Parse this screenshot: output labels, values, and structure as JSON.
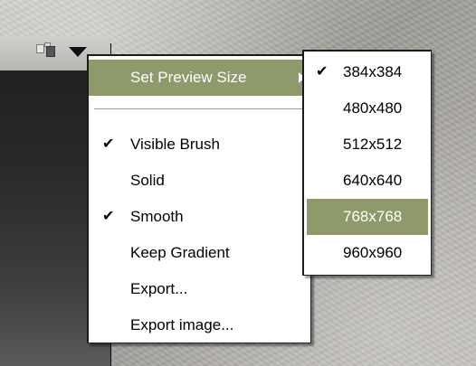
{
  "main_menu": {
    "items": [
      {
        "label": "Set Preview Size",
        "checked": false,
        "highlighted": true,
        "has_submenu": true
      },
      {
        "label": "Visible Brush",
        "checked": true
      },
      {
        "label": "Solid",
        "checked": false
      },
      {
        "label": "Smooth",
        "checked": true
      },
      {
        "label": "Keep Gradient",
        "checked": false
      },
      {
        "label": "Export...",
        "checked": false
      },
      {
        "label": "Export image...",
        "checked": false
      }
    ]
  },
  "submenu": {
    "items": [
      {
        "label": "384x384",
        "checked": true
      },
      {
        "label": "480x480",
        "checked": false
      },
      {
        "label": "512x512",
        "checked": false
      },
      {
        "label": "640x640",
        "checked": false
      },
      {
        "label": "768x768",
        "checked": false,
        "highlighted": true
      },
      {
        "label": "960x960",
        "checked": false
      }
    ]
  },
  "check_glyph": "✔",
  "colors": {
    "highlight": "#8f9a6c",
    "menu_bg": "#ffffff"
  },
  "icons": {
    "toolbar": "palette-icon",
    "dropdown": "dropdown-arrow-icon",
    "submenu": "submenu-arrow-icon"
  }
}
